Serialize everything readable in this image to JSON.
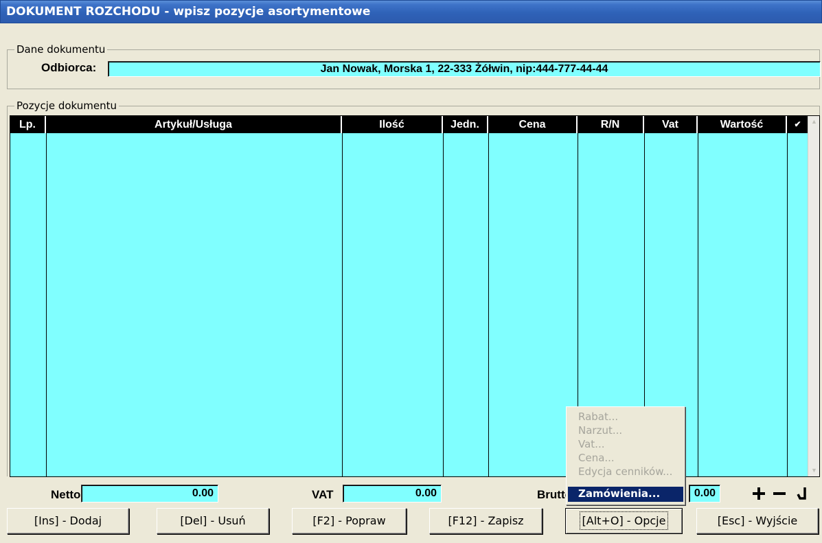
{
  "window": {
    "title": "DOKUMENT ROZCHODU - wpisz pozycje asortymentowe"
  },
  "header_group": {
    "legend": "Dane dokumentu",
    "odbiorca_label": "Odbiorca:",
    "odbiorca_value": "Jan Nowak, Morska 1,  22-333 Żółwin, nip:444-777-44-44"
  },
  "items_group": {
    "legend": "Pozycje dokumentu",
    "columns": [
      "Lp.",
      "Artykuł/Usługa",
      "Ilość",
      "Jedn.",
      "Cena",
      "R/N",
      "Vat",
      "Wartość",
      "✔"
    ]
  },
  "totals": {
    "netto_label": "Netto",
    "netto_value": "0.00",
    "vat_label": "VAT",
    "vat_value": "0.00",
    "brutto_label": "Brutto",
    "brutto_value": "0.00"
  },
  "icons": {
    "plus": "plus-icon",
    "minus": "minus-icon",
    "check": "checkmark-icon"
  },
  "buttons": {
    "add": "[Ins] - Dodaj",
    "delete": "[Del] - Usuń",
    "edit": "[F2] - Popraw",
    "save": "[F12] - Zapisz",
    "options": "[Alt+O] - Opcje",
    "exit": "[Esc] - Wyjście"
  },
  "context_menu": {
    "items": [
      "Rabat...",
      "Narzut...",
      "Vat...",
      "Cena...",
      "Edycja cenników...",
      "Zamówienia..."
    ],
    "selected": "Zamówienia..."
  },
  "colors": {
    "field_bg": "#80ffff",
    "grid_header": "#000000",
    "window_bg": "#ece9d8",
    "menu_selected": "#0a2569"
  }
}
